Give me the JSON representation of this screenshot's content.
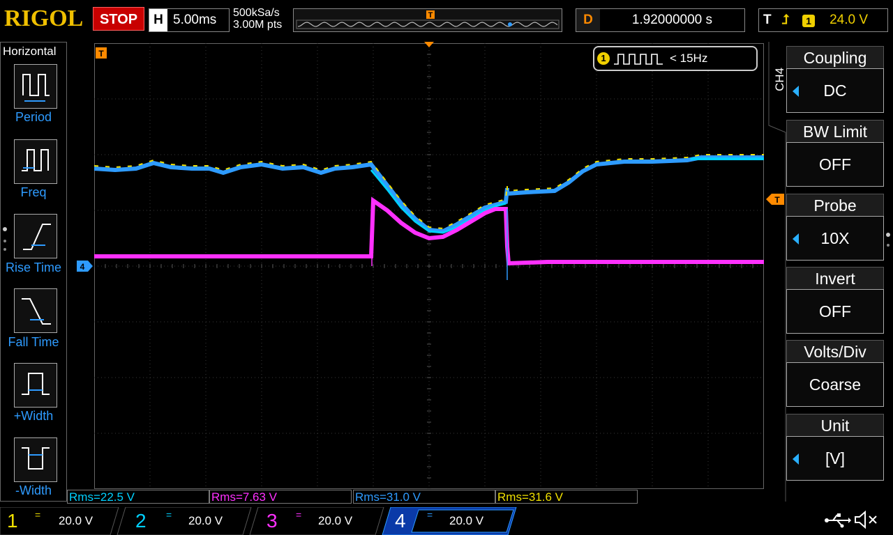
{
  "brand": "RIGOL",
  "run_state": "STOP",
  "horizontal": {
    "label": "H",
    "timebase": "5.00ms",
    "sample_rate": "500kSa/s",
    "memory_depth": "3.00M pts"
  },
  "delay": {
    "label": "D",
    "value": "1.92000000 s"
  },
  "trigger": {
    "label": "T",
    "source": "1",
    "level": "24.0 V",
    "popup_source": "1",
    "popup_freq": "< 15Hz"
  },
  "left_menu": {
    "title": "Horizontal",
    "items": [
      {
        "label": "Period",
        "icon": "period-icon"
      },
      {
        "label": "Freq",
        "icon": "freq-icon"
      },
      {
        "label": "Rise Time",
        "icon": "rise-time-icon"
      },
      {
        "label": "Fall Time",
        "icon": "fall-time-icon"
      },
      {
        "label": "+Width",
        "icon": "positive-width-icon"
      },
      {
        "label": "-Width",
        "icon": "negative-width-icon"
      }
    ]
  },
  "right_menu": {
    "channel": "CH4",
    "items": [
      {
        "title": "Coupling",
        "value": "DC",
        "arrow": true
      },
      {
        "title": "BW Limit",
        "value": "OFF",
        "arrow": false
      },
      {
        "title": "Probe",
        "value": "10X",
        "arrow": true
      },
      {
        "title": "Invert",
        "value": "OFF",
        "arrow": false
      },
      {
        "title": "Volts/Div",
        "value": "Coarse",
        "arrow": false
      },
      {
        "title": "Unit",
        "value": "[V]",
        "arrow": true
      }
    ]
  },
  "measurements": [
    {
      "text": "Rms=22.5 V",
      "color": "#00d0ff"
    },
    {
      "text": "Rms=7.63 V",
      "color": "#ff30ff"
    },
    {
      "text": "Rms=31.0 V",
      "color": "#2e9bff"
    },
    {
      "text": "Rms=31.6 V",
      "color": "#f0e000"
    }
  ],
  "channels": [
    {
      "num": "1",
      "scale": "20.0 V",
      "color": "#f0e000"
    },
    {
      "num": "2",
      "scale": "20.0 V",
      "color": "#00d0ff"
    },
    {
      "num": "3",
      "scale": "20.0 V",
      "color": "#ff30ff"
    },
    {
      "num": "4",
      "scale": "20.0 V",
      "color": "#2e9bff"
    }
  ],
  "markers": {
    "trigger_pos": "T",
    "ch4_ref": "4",
    "trig_level": "T"
  },
  "colors": {
    "ch1": "#f0e000",
    "ch2": "#00d0ff",
    "ch3": "#ff30ff",
    "ch4": "#2e9bff",
    "accent": "#ff8a00"
  }
}
